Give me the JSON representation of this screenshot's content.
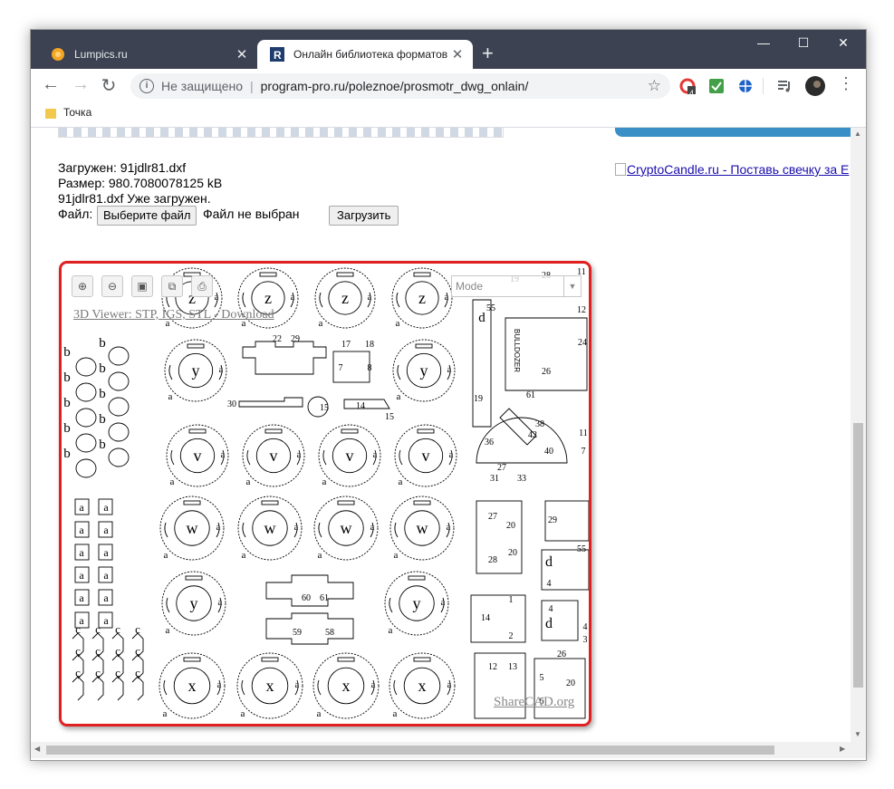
{
  "browser": {
    "tabs": [
      {
        "title": "Lumpics.ru",
        "active": false
      },
      {
        "title": "Онлайн библиотека форматов",
        "active": true
      }
    ],
    "new_tab": "+",
    "window_controls": {
      "minimize": "—",
      "maximize": "☐",
      "close": "✕"
    },
    "security_label": "Не защищено",
    "url": "program-pro.ru/poleznoe/prosmotr_dwg_onlain/",
    "extension_badge": "4",
    "bookmarks": [
      {
        "label": "Точка"
      }
    ]
  },
  "page": {
    "loaded_label": "Загружен: 91jdlr81.dxf",
    "size_label": "Размер: 980.7080078125 kB",
    "already_loaded": "91jdlr81.dxf Уже загружен.",
    "file_label": "Файл:",
    "choose_file_button": "Выберите файл",
    "no_file_chosen": "Файл не выбран",
    "upload_button": "Загрузить"
  },
  "viewer": {
    "link_text": "3D Viewer: STP, IGS, STL - Download",
    "mode_placeholder": "Mode",
    "watermark": "ShareCAD.org",
    "drawing_labels": [
      "z",
      "y",
      "v",
      "w",
      "a",
      "b",
      "c",
      "d",
      "x",
      "1",
      "2",
      "3",
      "4",
      "5",
      "6",
      "7",
      "8",
      "11",
      "12",
      "13",
      "14",
      "15",
      "17",
      "18",
      "19",
      "20",
      "22",
      "24",
      "26",
      "27",
      "28",
      "29",
      "30",
      "31",
      "33",
      "36",
      "38",
      "40",
      "42",
      "55",
      "58",
      "59",
      "60",
      "61",
      "BULLDOZER"
    ]
  },
  "sidebar": {
    "ad_link": "CryptoCandle.ru - Поставь свечку за E"
  },
  "colors": {
    "titlebar": "#3c4251",
    "highlight": "#e02020",
    "link": "#1a0dab",
    "ad_accent": "#3a8fc6"
  }
}
